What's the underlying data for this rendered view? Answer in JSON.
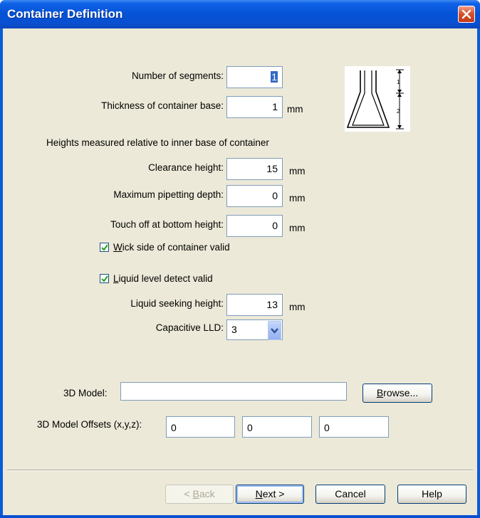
{
  "window": {
    "title": "Container Definition"
  },
  "icons": {
    "close": "close-icon",
    "check": "checkmark-icon",
    "dropdown": "chevron-down-icon",
    "diagram": "flask-segments-diagram"
  },
  "fields": {
    "segments": {
      "label": "Number of segments:",
      "value": "1"
    },
    "base_thickness": {
      "label": "Thickness of container base:",
      "value": "1",
      "unit": "mm"
    },
    "heights_note": "Heights measured relative to inner base of container",
    "clearance": {
      "label": "Clearance height:",
      "value": "15",
      "unit": "mm"
    },
    "max_depth": {
      "label": "Maximum pipetting depth:",
      "value": "0",
      "unit": "mm"
    },
    "touch_off": {
      "label": "Touch off at bottom height:",
      "value": "0",
      "unit": "mm"
    },
    "wick": {
      "label_key": "W",
      "label_rest": "ick side of container valid",
      "checked": true
    },
    "lld": {
      "label_key": "L",
      "label_rest": "iquid level detect valid",
      "checked": true
    },
    "seeking": {
      "label": "Liquid seeking height:",
      "value": "13",
      "unit": "mm"
    },
    "capacitive": {
      "label": "Capacitive LLD:",
      "value": "3"
    },
    "model": {
      "label": "3D Model:",
      "value": ""
    },
    "browse": {
      "key": "B",
      "rest": "rowse..."
    },
    "offsets": {
      "label": "3D Model Offsets (x,y,z):",
      "x": "0",
      "y": "0",
      "z": "0"
    }
  },
  "diagram": {
    "label1": "1",
    "label2": "2"
  },
  "buttons": {
    "back": {
      "prefix": "< ",
      "key": "B",
      "rest": "ack",
      "disabled": true
    },
    "next": {
      "key": "N",
      "rest": "ext >"
    },
    "cancel": "Cancel",
    "help": "Help"
  },
  "colors": {
    "title_bar": "#0453d6",
    "face": "#ece9d8",
    "close": "#d9522d",
    "selection": "#316ac5"
  }
}
